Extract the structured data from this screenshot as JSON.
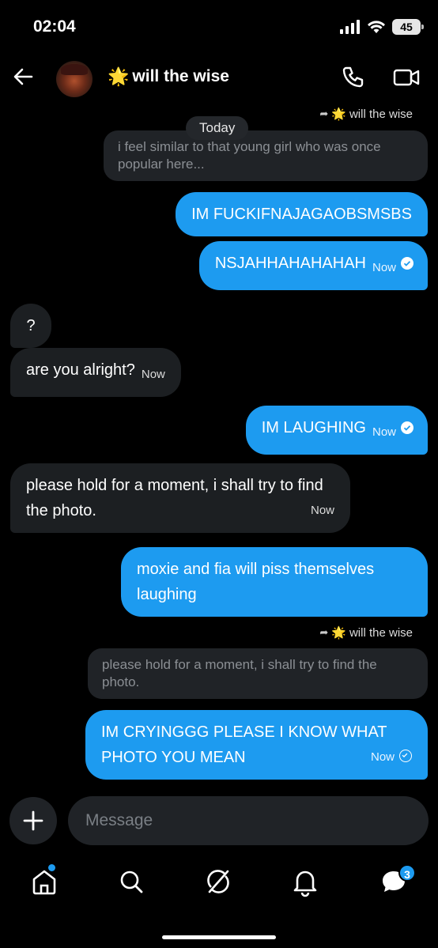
{
  "status": {
    "time": "02:04",
    "battery": "45"
  },
  "header": {
    "back_icon": "arrow-left-icon",
    "title": "will the wise",
    "title_emoji": "🌟",
    "call_icon": "phone-icon",
    "video_icon": "video-icon"
  },
  "thread": {
    "today": "Today",
    "reply_to_1": "will the wise",
    "quote_1": "i feel similar to that young girl who was once popular here...",
    "messages": [
      {
        "dir": "out",
        "text": "IM FUCKIFNAJAGAOBSMSBS"
      },
      {
        "dir": "out",
        "text": "NSJAHHAHAHAHAH",
        "time": "Now"
      },
      {
        "dir": "in",
        "text": "?"
      },
      {
        "dir": "in",
        "text": "are you alright?",
        "time": "Now"
      },
      {
        "dir": "out",
        "text": "IM LAUGHING",
        "time": "Now"
      },
      {
        "dir": "in",
        "text": "please hold for a moment, i shall try to find the photo.",
        "time": "Now"
      },
      {
        "dir": "out",
        "text": "moxie and fia will piss themselves laughing"
      },
      {
        "dir": "out",
        "text": "IM CRYINGGG PLEASE I KNOW WHAT PHOTO YOU MEAN",
        "time": "Now"
      }
    ],
    "reply_to_2": "will the wise",
    "quote_2": "please hold for a moment, i shall try to find the photo."
  },
  "composer": {
    "placeholder": "Message",
    "add_icon": "plus-icon"
  },
  "tabbar": {
    "icons": [
      "home-icon",
      "search-icon",
      "grok-icon",
      "bell-icon",
      "messages-icon"
    ],
    "messages_badge": "3"
  },
  "colors": {
    "accent": "#1d9bf0",
    "incoming": "#1c1f22",
    "background": "#000000"
  }
}
